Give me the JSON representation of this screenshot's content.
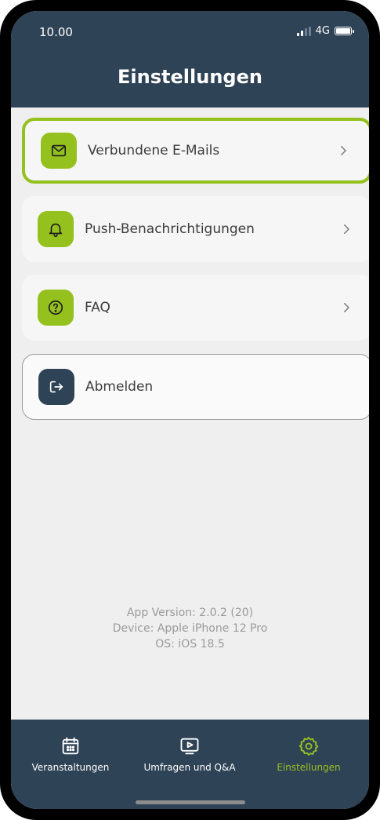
{
  "status_bar": {
    "time": "10.00",
    "network": "4G"
  },
  "header": {
    "title": "Einstellungen"
  },
  "menu": {
    "items": [
      {
        "label": "Verbundene E-Mails",
        "icon": "mail-icon",
        "highlighted": true
      },
      {
        "label": "Push-Benachrichtigungen",
        "icon": "bell-icon"
      },
      {
        "label": "FAQ",
        "icon": "question-icon"
      }
    ],
    "logout": {
      "label": "Abmelden",
      "icon": "logout-icon"
    }
  },
  "info": {
    "app_version": "App Version: 2.0.2 (20)",
    "device": "Device: Apple iPhone 12 Pro",
    "os": "OS: iOS 18.5"
  },
  "tabbar": {
    "tabs": [
      {
        "label": "Veranstaltungen",
        "icon": "calendar-icon"
      },
      {
        "label": "Umfragen und Q&A",
        "icon": "play-screen-icon"
      },
      {
        "label": "Einstellungen",
        "icon": "gear-icon",
        "active": true
      }
    ]
  },
  "colors": {
    "accent": "#95c11f",
    "header": "#2f4356",
    "background": "#efefef"
  }
}
